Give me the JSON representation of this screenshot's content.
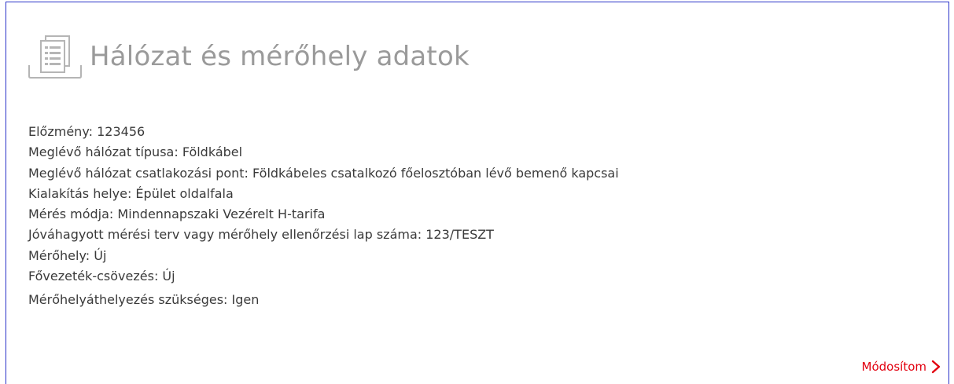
{
  "section": {
    "title": "Hálózat és mérőhely adatok",
    "icon": "document-list-icon"
  },
  "details": [
    {
      "label": "Előzmény",
      "value": "123456",
      "text": "Előzmény: 123456"
    },
    {
      "label": "Meglévő hálózat típusa",
      "value": "Földkábel",
      "text": "Meglévő hálózat típusa: Földkábel"
    },
    {
      "label": "Meglévő hálózat csatlakozási pont",
      "value": "Földkábeles csatalkozó főelosztóban lévő bemenő kapcsai",
      "text": "Meglévő hálózat csatlakozási pont: Földkábeles csatalkozó főelosztóban lévő bemenő kapcsai"
    },
    {
      "label": "Kialakítás helye",
      "value": "Épület oldalfala",
      "text": "Kialakítás helye: Épület oldalfala"
    },
    {
      "label": "Mérés módja",
      "value": "Mindennapszaki Vezérelt H-tarifa",
      "text": "Mérés módja: Mindennapszaki Vezérelt H-tarifa"
    },
    {
      "label": "Jóváhagyott mérési terv vagy mérőhely ellenőrzési lap száma",
      "value": "123/TESZT",
      "text": "Jóváhagyott mérési terv vagy mérőhely ellenőrzési lap száma: 123/TESZT"
    },
    {
      "label": "Mérőhely",
      "value": "Új",
      "text": "Mérőhely: Új"
    },
    {
      "label": "Fővezeték-csövezés",
      "value": "Új",
      "text": "Fővezeték-csövezés: Új"
    },
    {
      "label": "Mérőhelyáthelyezés szükséges",
      "value": "Igen",
      "text": "Mérőhelyáthelyezés szükséges: Igen"
    }
  ],
  "actions": {
    "modify_label": "Módosítom",
    "modify_icon": "chevron-right-icon"
  },
  "colors": {
    "accent": "#e2000f",
    "border": "#2a33c9",
    "title": "#9a9a9a",
    "text": "#3a3a3a"
  }
}
